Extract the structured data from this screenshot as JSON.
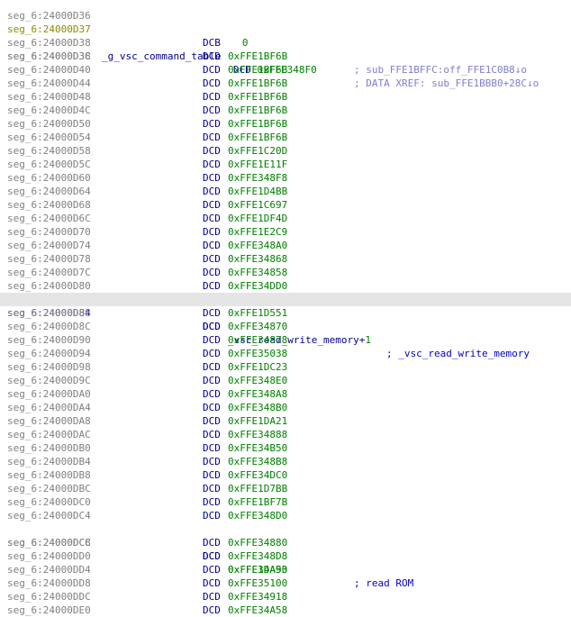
{
  "lines": [
    {
      "addr": "seg_6:24000D36",
      "mnem": "",
      "operand": ""
    },
    {
      "addr": "seg_6:24000D37",
      "mnem": "DCB",
      "operand": "0"
    },
    {
      "addr": "seg_6:24000D38",
      "label": "_g_vsc_command_table",
      "mnem": "DCD",
      "operand": "0xFFE348F0",
      "xref": "; DATA XREF: sub_FFE1BBB0+28C↓o"
    },
    {
      "addr": "seg_6:24000D38",
      "xref": "; sub_FFE1BFFC:off_FFE1C0B8↓o"
    },
    {
      "addr": "seg_6:24000D3C",
      "mnem": "DCD",
      "operand": "0xFFE1BF6B"
    },
    {
      "addr": "seg_6:24000D40",
      "mnem": "DCD",
      "operand": "0xFFE1BF6B"
    },
    {
      "addr": "seg_6:24000D44",
      "mnem": "DCD",
      "operand": "0xFFE1BF6B"
    },
    {
      "addr": "seg_6:24000D48",
      "mnem": "DCD",
      "operand": "0xFFE1BF6B"
    },
    {
      "addr": "seg_6:24000D4C",
      "mnem": "DCD",
      "operand": "0xFFE1BF6B"
    },
    {
      "addr": "seg_6:24000D50",
      "mnem": "DCD",
      "operand": "0xFFE1BF6B"
    },
    {
      "addr": "seg_6:24000D54",
      "mnem": "DCD",
      "operand": "0xFFE1BF6B"
    },
    {
      "addr": "seg_6:24000D58",
      "mnem": "DCD",
      "operand": "0xFFE1C20D"
    },
    {
      "addr": "seg_6:24000D5C",
      "mnem": "DCD",
      "operand": "0xFFE1E11F"
    },
    {
      "addr": "seg_6:24000D60",
      "mnem": "DCD",
      "operand": "0xFFE348F8"
    },
    {
      "addr": "seg_6:24000D64",
      "mnem": "DCD",
      "operand": "0xFFE1D4BB"
    },
    {
      "addr": "seg_6:24000D68",
      "mnem": "DCD",
      "operand": "0xFFE1C697"
    },
    {
      "addr": "seg_6:24000D6C",
      "mnem": "DCD",
      "operand": "0xFFE1DF4D"
    },
    {
      "addr": "seg_6:24000D70",
      "mnem": "DCD",
      "operand": "0xFFE1E2C9"
    },
    {
      "addr": "seg_6:24000D74",
      "mnem": "DCD",
      "operand": "0xFFE348A0"
    },
    {
      "addr": "seg_6:24000D78",
      "mnem": "DCD",
      "operand": "0xFFE34868"
    },
    {
      "addr": "seg_6:24000D7C",
      "mnem": "DCD",
      "operand": "0xFFE34858"
    },
    {
      "addr": "seg_6:24000D80",
      "mnem": "DCD",
      "operand": "0xFFE34DD0"
    },
    {
      "addr": "seg_6:24000D84",
      "mnem": "DCD",
      "name": "_vsc_read_write_memory",
      "plus": "+",
      "plusnum": "1",
      "comment": "; _vsc_read_write_memory"
    },
    {
      "addr": "seg_6:24000D88",
      "mnem": "DCD",
      "operand": "0xFFE1D551"
    },
    {
      "addr": "seg_6:24000D8C",
      "mnem": "DCD",
      "operand": "0xFFE34870"
    },
    {
      "addr": "seg_6:24000D90",
      "mnem": "DCD",
      "operand": "0xFFE34878"
    },
    {
      "addr": "seg_6:24000D94",
      "mnem": "DCD",
      "operand": "0xFFE35038"
    },
    {
      "addr": "seg_6:24000D98",
      "mnem": "DCD",
      "operand": "0xFFE1DC23"
    },
    {
      "addr": "seg_6:24000D9C",
      "mnem": "DCD",
      "operand": "0xFFE348E0"
    },
    {
      "addr": "seg_6:24000DA0",
      "mnem": "DCD",
      "operand": "0xFFE348A8"
    },
    {
      "addr": "seg_6:24000DA4",
      "mnem": "DCD",
      "operand": "0xFFE348B0"
    },
    {
      "addr": "seg_6:24000DA8",
      "mnem": "DCD",
      "operand": "0xFFE1DA21"
    },
    {
      "addr": "seg_6:24000DAC",
      "mnem": "DCD",
      "operand": "0xFFE34888"
    },
    {
      "addr": "seg_6:24000DB0",
      "mnem": "DCD",
      "operand": "0xFFE34B50"
    },
    {
      "addr": "seg_6:24000DB4",
      "mnem": "DCD",
      "operand": "0xFFE348B8"
    },
    {
      "addr": "seg_6:24000DB8",
      "mnem": "DCD",
      "operand": "0xFFE34DC0"
    },
    {
      "addr": "seg_6:24000DBC",
      "mnem": "DCD",
      "operand": "0xFFE1D7BB"
    },
    {
      "addr": "seg_6:24000DC0",
      "mnem": "DCD",
      "operand": "0xFFE1BF7B"
    },
    {
      "addr": "seg_6:24000DC4",
      "mnem": "DCD",
      "operand": "0xFFE348D0"
    },
    {
      "addr": "seg_6:24000DC8",
      "mnem": "DCD",
      "operand": "0xFFE1DA93",
      "comment": "; read ROM"
    },
    {
      "addr": "seg_6:24000DCC",
      "mnem": "DCD",
      "operand": "0xFFE34880"
    },
    {
      "addr": "seg_6:24000DD0",
      "mnem": "DCD",
      "operand": "0xFFE348D8"
    },
    {
      "addr": "seg_6:24000DD4",
      "mnem": "DCD",
      "operand": "0xFFE34A50"
    },
    {
      "addr": "seg_6:24000DD8",
      "mnem": "DCD",
      "operand": "0xFFE35100"
    },
    {
      "addr": "seg_6:24000DDC",
      "mnem": "DCD",
      "operand": "0xFFE34918"
    },
    {
      "addr": "seg_6:24000DE0",
      "mnem": "DCD",
      "operand": "0xFFE34A58"
    }
  ]
}
